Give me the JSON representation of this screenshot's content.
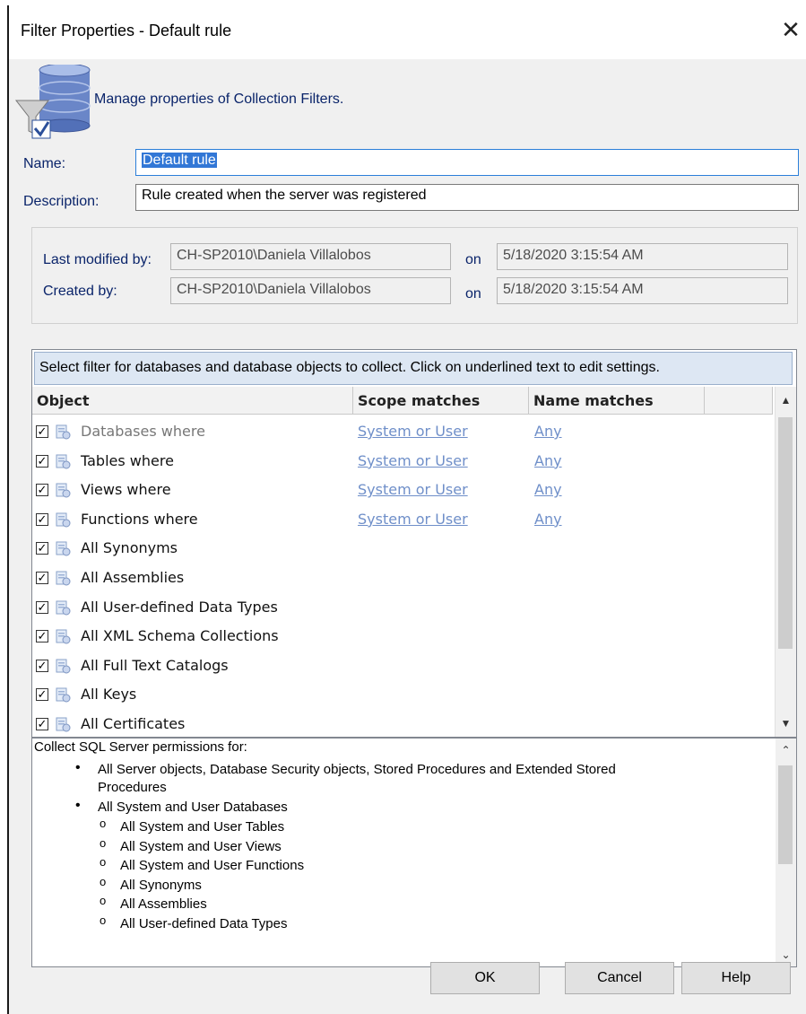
{
  "window": {
    "title": "Filter Properties - Default rule"
  },
  "header": {
    "description": "Manage properties of Collection Filters."
  },
  "form": {
    "name_label": "Name:",
    "name_value": "Default rule",
    "description_label": "Description:",
    "description_value": "Rule created when the server was registered"
  },
  "meta": {
    "last_modified_label": "Last modified by:",
    "last_modified_by": "CH-SP2010\\Daniela Villalobos",
    "on_label_1": "on",
    "last_modified_on": "5/18/2020 3:15:54 AM",
    "created_label": "Created by:",
    "created_by": "CH-SP2010\\Daniela Villalobos",
    "on_label_2": "on",
    "created_on": "5/18/2020 3:15:54 AM"
  },
  "grid": {
    "banner": "Select filter for databases and database objects to collect. Click on underlined text to edit settings.",
    "columns": [
      "Object",
      "Scope matches",
      "Name matches"
    ],
    "rows": [
      {
        "object": "Databases where",
        "scope": "System or User",
        "name": "Any",
        "checked": true
      },
      {
        "object": "Tables where",
        "scope": "System or User",
        "name": "Any",
        "checked": true
      },
      {
        "object": "Views where",
        "scope": "System or User",
        "name": "Any",
        "checked": true
      },
      {
        "object": "Functions where",
        "scope": "System or User",
        "name": "Any",
        "checked": true
      },
      {
        "object": "All Synonyms",
        "scope": "",
        "name": "",
        "checked": true
      },
      {
        "object": "All Assemblies",
        "scope": "",
        "name": "",
        "checked": true
      },
      {
        "object": "All User-defined Data Types",
        "scope": "",
        "name": "",
        "checked": true
      },
      {
        "object": "All XML Schema Collections",
        "scope": "",
        "name": "",
        "checked": true
      },
      {
        "object": "All Full Text Catalogs",
        "scope": "",
        "name": "",
        "checked": true
      },
      {
        "object": "All Keys",
        "scope": "",
        "name": "",
        "checked": true
      },
      {
        "object": "All Certificates",
        "scope": "",
        "name": "",
        "checked": true
      }
    ]
  },
  "summary": {
    "heading": "Collect SQL Server permissions for:",
    "bullet1_line1": "All Server objects, Database Security objects, Stored Procedures and Extended Stored",
    "bullet1_line2": "Procedures",
    "bullet2": "All System and User Databases",
    "sub_items": [
      "All System and User Tables",
      "All System and User Views",
      "All System and User Functions",
      "All Synonyms",
      "All Assemblies",
      "All User-defined Data Types"
    ]
  },
  "buttons": {
    "ok": "OK",
    "cancel": "Cancel",
    "help": "Help"
  }
}
